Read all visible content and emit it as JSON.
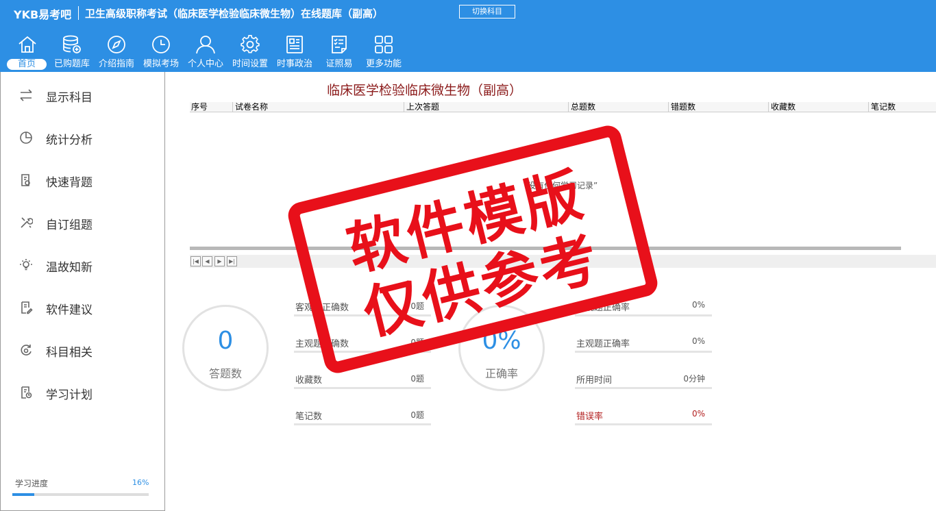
{
  "header": {
    "brand": "YKB易考吧",
    "title": "卫生高级职称考试（临床医学检验临床微生物）在线题库（副高）",
    "switch_label": "切换科目"
  },
  "nav": {
    "home": "首页",
    "purchased": "已购题库",
    "guide": "介绍指南",
    "mock": "模拟考场",
    "user": "个人中心",
    "time": "时间设置",
    "politics": "时事政治",
    "cert": "证照易",
    "more": "更多功能"
  },
  "sidebar": {
    "items": [
      "显示科目",
      "统计分析",
      "快速背题",
      "自订组题",
      "温故知新",
      "软件建议",
      "科目相关",
      "学习计划"
    ],
    "progress_label": "学习进度",
    "progress_value": "16%",
    "progress_fraction": 0.16
  },
  "main": {
    "exam_title": "临床医学检验临床微生物（副高）",
    "columns": [
      "序号",
      "试卷名称",
      "上次答题",
      "总题数",
      "错题数",
      "收藏数",
      "笔记数"
    ],
    "empty_message": "没有任何学习记录”"
  },
  "stats": {
    "answered_value": "0",
    "answered_label": "答题数",
    "accuracy_value": "0%",
    "accuracy_label": "正确率",
    "left": [
      {
        "label": "客观题正确数",
        "value": "0题"
      },
      {
        "label": "主观题正确数",
        "value": "0题"
      },
      {
        "label": "收藏数",
        "value": "0题"
      },
      {
        "label": "笔记数",
        "value": "0题"
      }
    ],
    "right": [
      {
        "label": "客观题正确率",
        "value": "0%"
      },
      {
        "label": "主观题正确率",
        "value": "0%"
      },
      {
        "label": "所用时间",
        "value": "0分钟"
      },
      {
        "label": "错误率",
        "value": "0%"
      }
    ]
  },
  "watermark": {
    "line1": "软件模版",
    "line2": "仅供参考"
  },
  "colors": {
    "header_bg": "#2d8fe4",
    "accent": "#2d8fe4",
    "title_red": "#8b1a1a",
    "stamp_red": "#e8101a"
  }
}
